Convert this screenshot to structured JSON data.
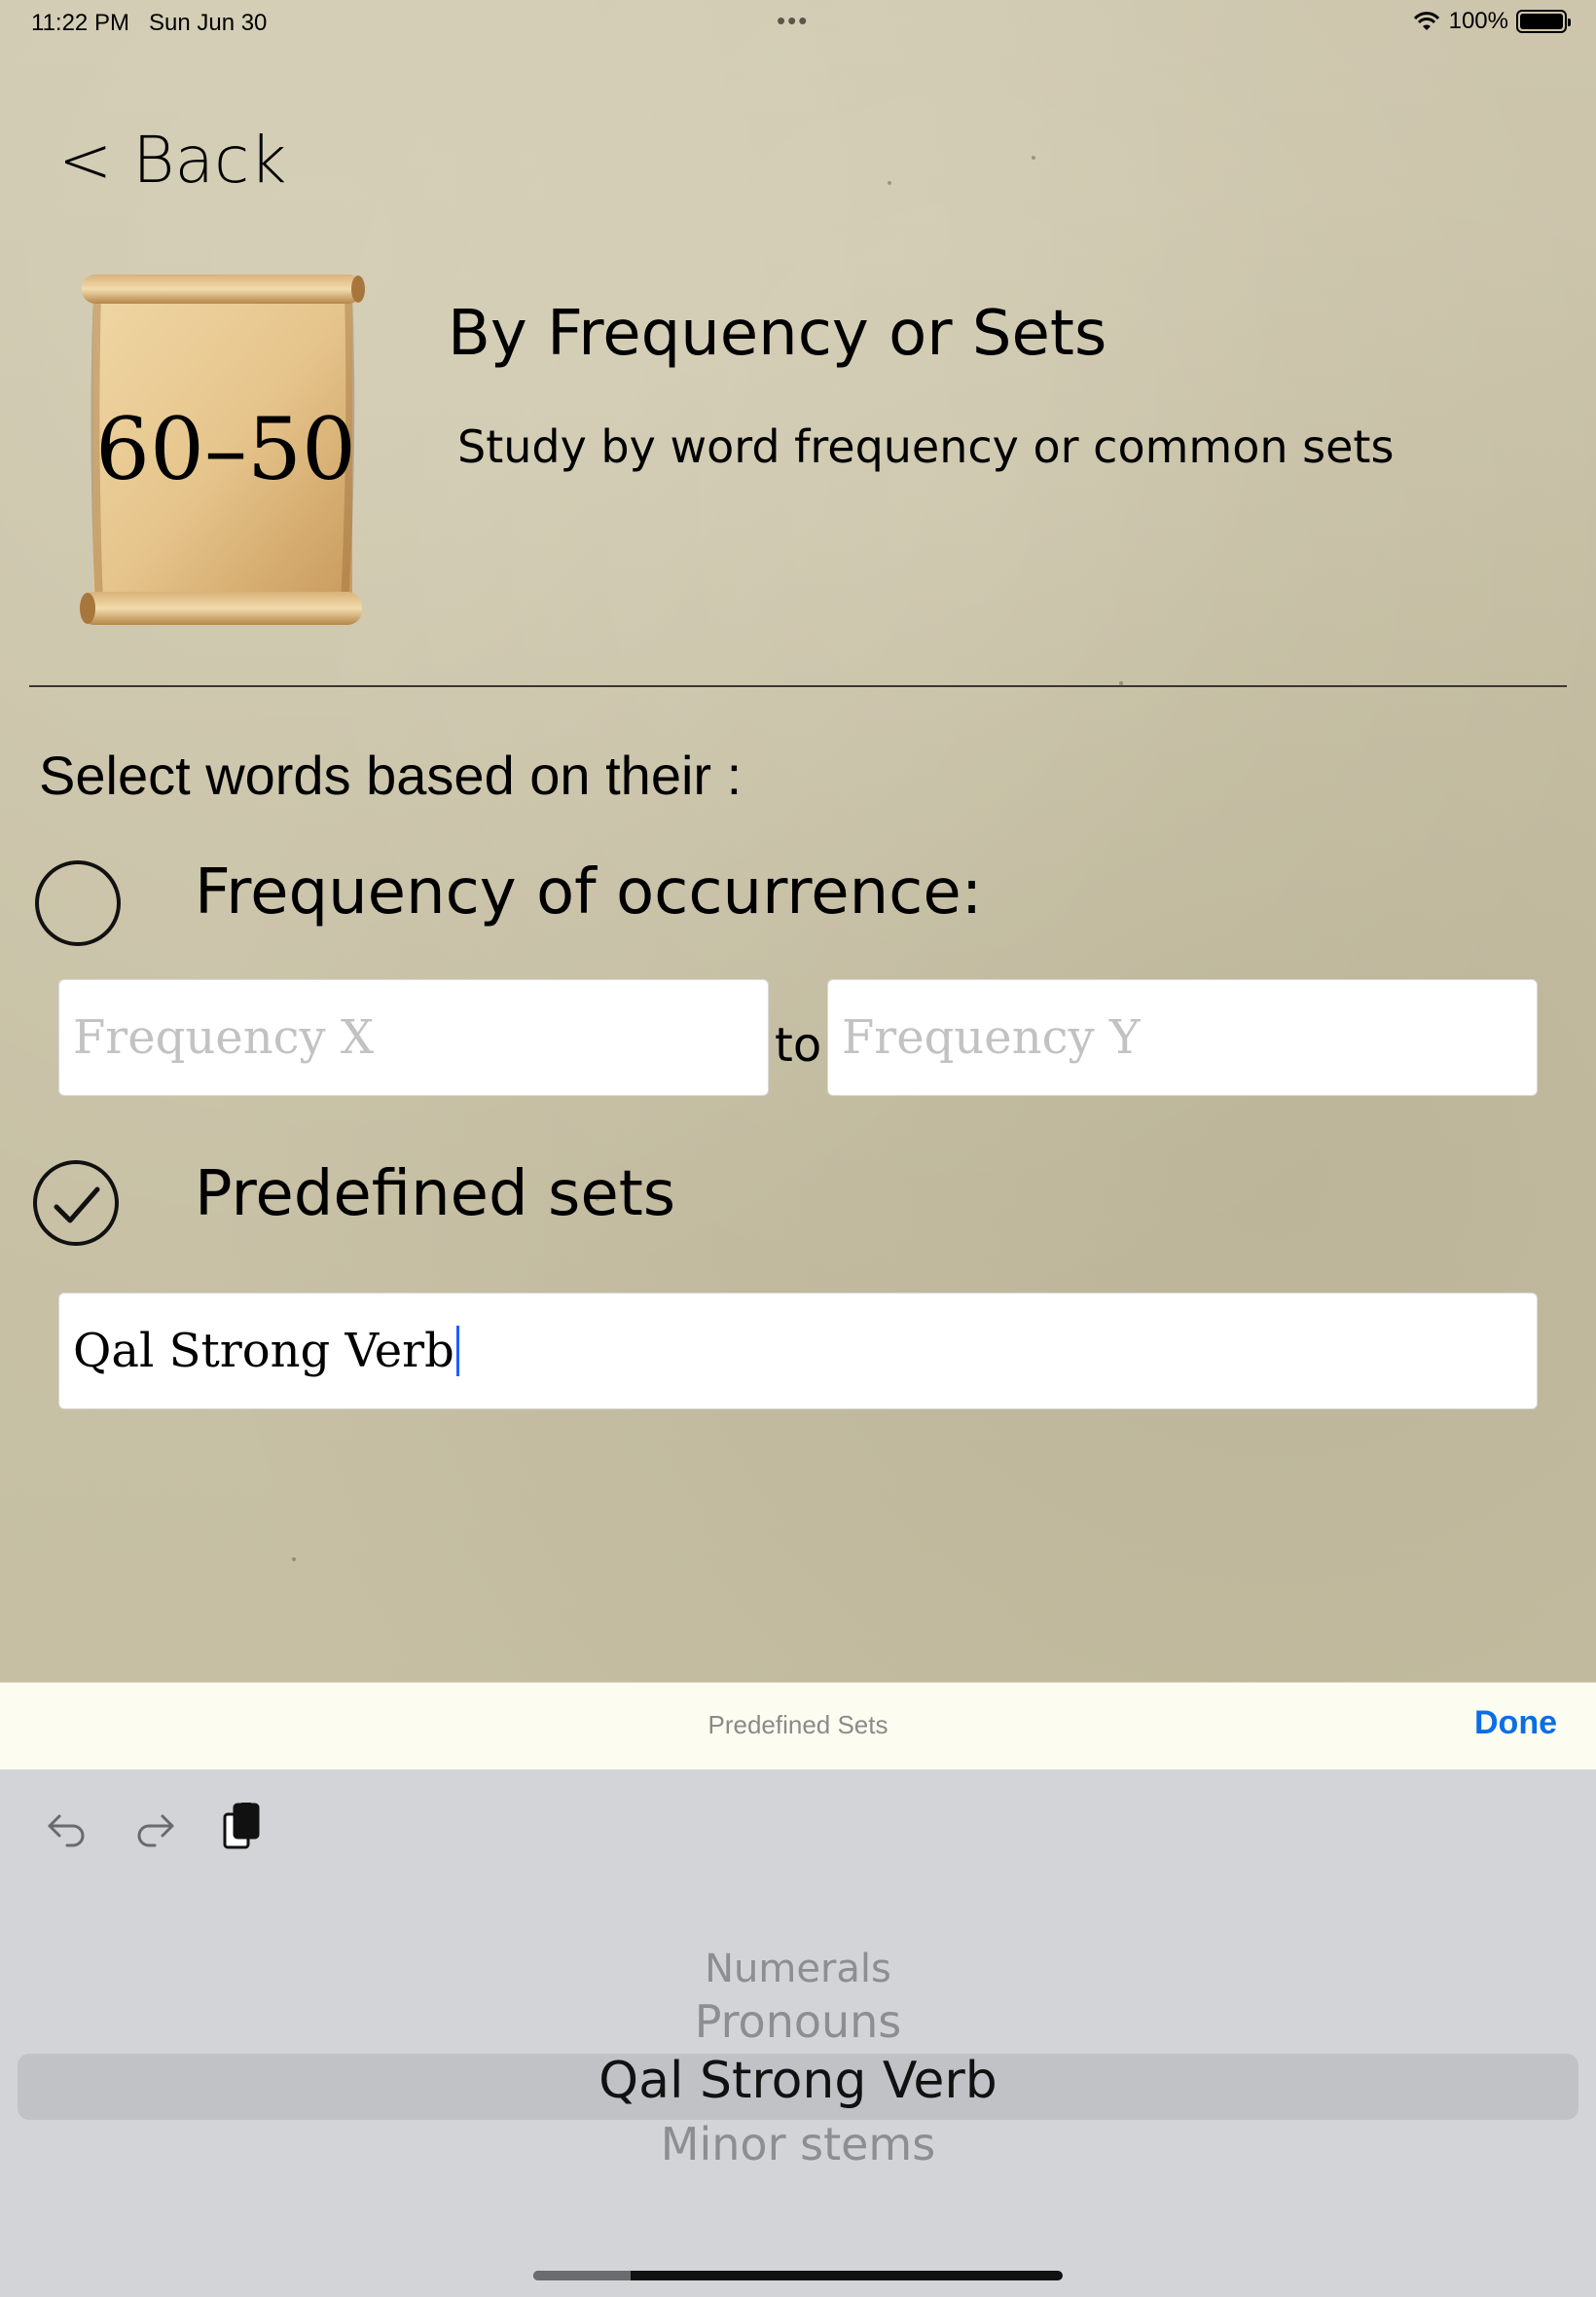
{
  "status_bar": {
    "time": "11:22 PM",
    "date": "Sun Jun 30",
    "battery": "100%",
    "battery_level": 1.0
  },
  "nav": {
    "back_label": "< Back"
  },
  "header": {
    "badge": "60–50",
    "title": "By Frequency or Sets",
    "subtitle": "Study by word frequency or common sets"
  },
  "form": {
    "prompt": "Select words based on their :",
    "frequency": {
      "label": "Frequency of occurrence:",
      "selected": false,
      "x_placeholder": "Frequency X",
      "y_placeholder": "Frequency Y",
      "separator": "to"
    },
    "sets": {
      "label": "Predefined sets",
      "selected": true,
      "value": "Qal Strong Verb"
    }
  },
  "accessory_bar": {
    "title": "Predefined Sets",
    "done_label": "Done"
  },
  "picker": {
    "items": [
      "Numerals",
      "Pronouns",
      "Qal Strong Verb",
      "Minor stems"
    ],
    "selected": "Qal Strong Verb"
  },
  "icons": {
    "undo": "undo-icon",
    "redo": "redo-icon",
    "paste": "paste-icon",
    "wifi": "wifi-icon",
    "battery": "battery-icon"
  },
  "colors": {
    "accent": "#0a6ee6",
    "caret": "#1f5eff",
    "paper": "#c9c2a8"
  }
}
